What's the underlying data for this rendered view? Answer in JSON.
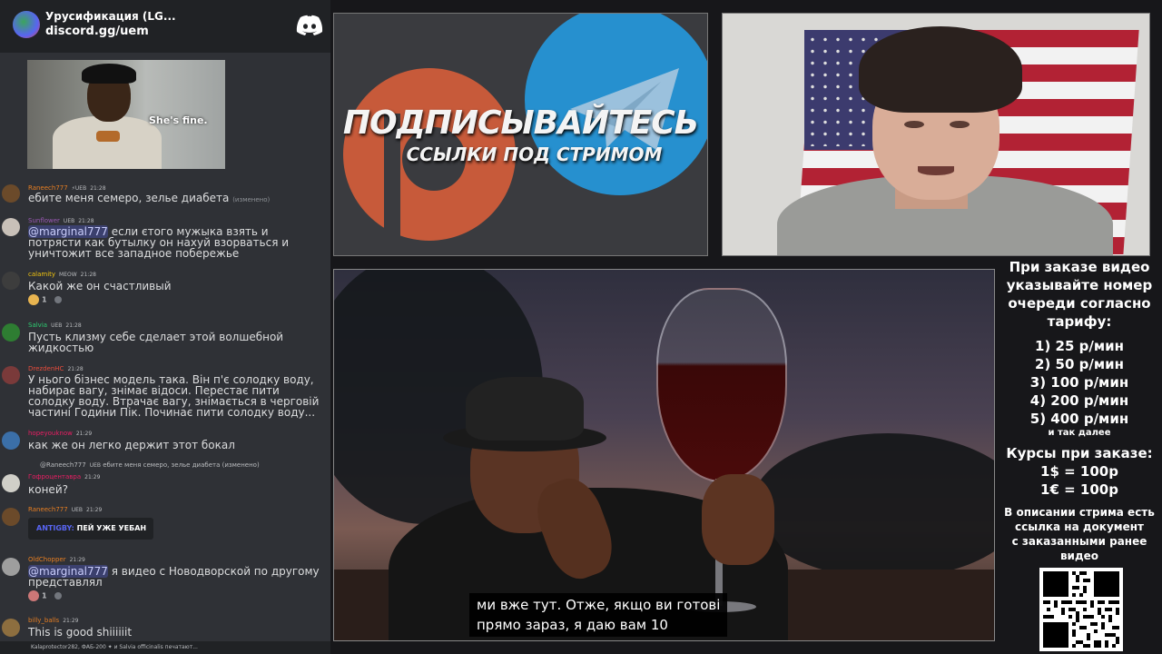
{
  "chat": {
    "server_name": "Урусификация (LG...",
    "server_link": "discord.gg/uem",
    "gif_caption": "She's fine.",
    "messages": [
      {
        "user": "Raneech777",
        "user_color": "#e67e22",
        "badge": "⚡UEB",
        "time": "21:28",
        "text": "ебите меня семеро, зелье диабета",
        "suffix": "(изменено)"
      },
      {
        "user": "Sunflower",
        "user_color": "#9b59b6",
        "badge": "UEB",
        "time": "21:28",
        "mention": "@marginal777",
        "text": "если єтого мужыка взять и потрясти как бутылку он нахуй взорваться и уничтожит все западное побережье"
      },
      {
        "user": "calamity",
        "user_color": "#f1c40f",
        "badge": "MEOW",
        "time": "21:28",
        "text": "Какой же он счастливый",
        "reaction_count": "1"
      },
      {
        "user": "Salvia",
        "user_color": "#2ecc71",
        "badge": "UEB",
        "time": "21:28",
        "text": "Пусть клизму себе сделает этой волшебной жидкостью"
      },
      {
        "user": "DrezdenHC",
        "user_color": "#e74c3c",
        "time": "21:28",
        "text": "У нього бізнес модель така. Він п'є солодку воду, набирає вагу, знімає відоси. Перестає пити солодку воду. Втрачає вагу, знімається в черговій частині Години Пік. Починає пити солодку воду..."
      },
      {
        "user": "hopeyouknow",
        "user_color": "#e91e63",
        "time": "21:29",
        "text": "как же он легко держит этот бокал"
      },
      {
        "reply_user": "@Raneech777",
        "reply_badge": "UEB",
        "reply_text": "ебите меня семеро, зелье диабета",
        "reply_suffix": "(изменено)",
        "user": "Гофроцентавра",
        "user_color": "#e91e63",
        "time": "21:29",
        "text": "коней?"
      },
      {
        "user": "Raneech777",
        "user_color": "#e67e22",
        "badge": "UEB",
        "time": "21:29",
        "embed_user": "ANTIGBY:",
        "embed_text": "ПЕЙ УЖЕ УЕБАН"
      },
      {
        "user": "OldChopper",
        "user_color": "#e67e22",
        "time": "21:29",
        "mention": "@marginal777",
        "text": "я видео с Новодворской по другому представлял",
        "reaction_count": "1"
      },
      {
        "user": "billy_balls",
        "user_color": "#e67e22",
        "time": "21:29",
        "text": "This is good shiiiiiit"
      }
    ],
    "footer": "Kalaprotector282, ФАБ-200 ✦ и Salvia officinalis печатают..."
  },
  "banner": {
    "title": "ПОДПИСЫВАЙТЕСЬ",
    "subtitle": "ССЫЛКИ ПОД СТРИМОМ"
  },
  "video": {
    "subtitle_line1": "ми вже тут.  Отже, якщо ви готові",
    "subtitle_line2": "прямо зараз, я даю вам 10"
  },
  "info": {
    "heading": [
      "При заказе видео",
      "указывайте номер",
      "очереди согласно",
      "тарифу:"
    ],
    "tariffs": [
      "1) 25 р/мин",
      "2) 50 р/мин",
      "3) 100 р/мин",
      "4) 200 р/мин",
      "5) 400 р/мин"
    ],
    "etc": "и так далее",
    "rates_heading": "Курсы при заказе:",
    "rates": [
      "1$ = 100р",
      "1€ = 100р"
    ],
    "description": [
      "В описании стрима есть",
      "ссылка на документ",
      "с заказанными ранее",
      "видео"
    ]
  },
  "colors": {
    "discord_bg": "#2f3136",
    "discord_header": "#202225",
    "telegram": "#2690cf",
    "patreon": "#e0603a"
  }
}
